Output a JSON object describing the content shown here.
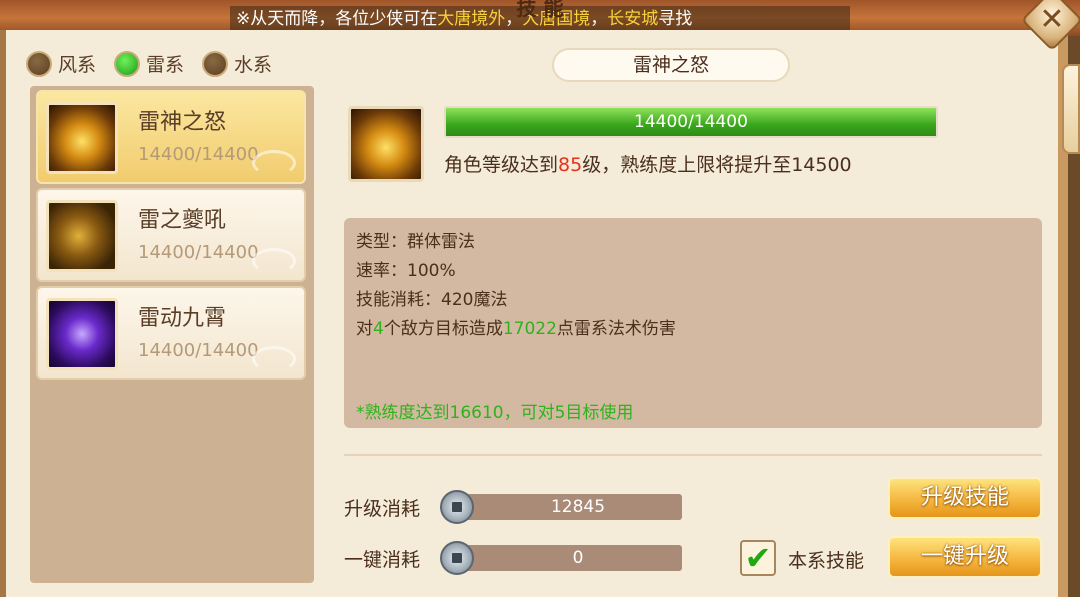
{
  "broadcast": {
    "prefix": "※从天而降，各位少侠可在",
    "loc1": "大唐境外",
    "sep1": "，",
    "loc2": "大唐国境",
    "sep2": "，",
    "loc3": "长安城",
    "suffix": "寻找"
  },
  "panel_title": "技 能",
  "close_label": "✕",
  "element_tabs": [
    {
      "label": "风系",
      "selected": false
    },
    {
      "label": "雷系",
      "selected": true
    },
    {
      "label": "水系",
      "selected": false
    }
  ],
  "skills": [
    {
      "name": "雷神之怒",
      "progress": "14400/14400",
      "icon": "thunder-wrath-icon",
      "active": true
    },
    {
      "name": "雷之夔吼",
      "progress": "14400/14400",
      "icon": "thunder-roar-icon",
      "active": false
    },
    {
      "name": "雷动九霄",
      "progress": "14400/14400",
      "icon": "thunder-storm-icon",
      "active": false
    }
  ],
  "detail": {
    "title": "雷神之怒",
    "exp_text": "14400/14400",
    "exp_fraction": 1.0,
    "level_note_prefix": "角色等级达到",
    "level_note_level": "85",
    "level_note_suffix": "级，熟练度上限将提升至14500",
    "type_line": "类型：群体雷法",
    "speed_line": "速率：100%",
    "cost_line": "技能消耗：420魔法",
    "effect_prefix": "对",
    "effect_targets": "4",
    "effect_mid": "个敌方目标造成",
    "effect_damage": "17022",
    "effect_suffix": "点雷系法术伤害",
    "tip": "*熟练度达到16610，可对5目标使用"
  },
  "costs": {
    "upgrade_label": "升级消耗",
    "upgrade_value": "12845",
    "oneclick_label": "一键消耗",
    "oneclick_value": "0"
  },
  "buttons": {
    "upgrade": "升级技能",
    "oneclick": "一键升级"
  },
  "checkbox": {
    "label": "本系技能",
    "checked": true,
    "mark": "✔"
  },
  "colors": {
    "accent_green": "#2fb21c",
    "highlight_red": "#e8311a",
    "button_gold": "#f4b33a"
  }
}
